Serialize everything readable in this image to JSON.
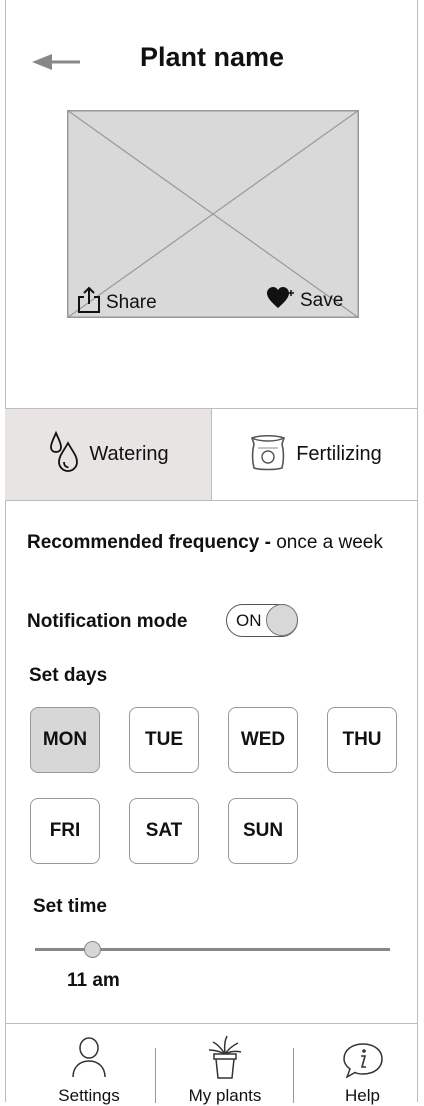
{
  "header": {
    "title": "Plant name"
  },
  "image_actions": {
    "share_label": "Share",
    "save_label": "Save"
  },
  "tabs": [
    {
      "label": "Watering",
      "icon": "water-drops-icon",
      "active": true
    },
    {
      "label": "Fertilizing",
      "icon": "fertilizer-bag-icon",
      "active": false
    }
  ],
  "frequency": {
    "label": "Recommended frequency -",
    "value": "once a week"
  },
  "notification": {
    "label": "Notification mode",
    "state": "ON"
  },
  "set_days": {
    "label": "Set days",
    "days": [
      {
        "label": "MON",
        "selected": true
      },
      {
        "label": "TUE",
        "selected": false
      },
      {
        "label": "WED",
        "selected": false
      },
      {
        "label": "THU",
        "selected": false
      },
      {
        "label": "FRI",
        "selected": false
      },
      {
        "label": "SAT",
        "selected": false
      },
      {
        "label": "SUN",
        "selected": false
      }
    ]
  },
  "set_time": {
    "label": "Set time",
    "value": "11 am"
  },
  "bottom_nav": [
    {
      "label": "Settings",
      "icon": "user-icon"
    },
    {
      "label": "My plants",
      "icon": "potted-plant-icon"
    },
    {
      "label": "Help",
      "icon": "info-icon"
    }
  ],
  "colors": {
    "active_tab": "#e8e4e3",
    "selected_day": "#d7d7d7",
    "placeholder": "#d9d9d9"
  }
}
